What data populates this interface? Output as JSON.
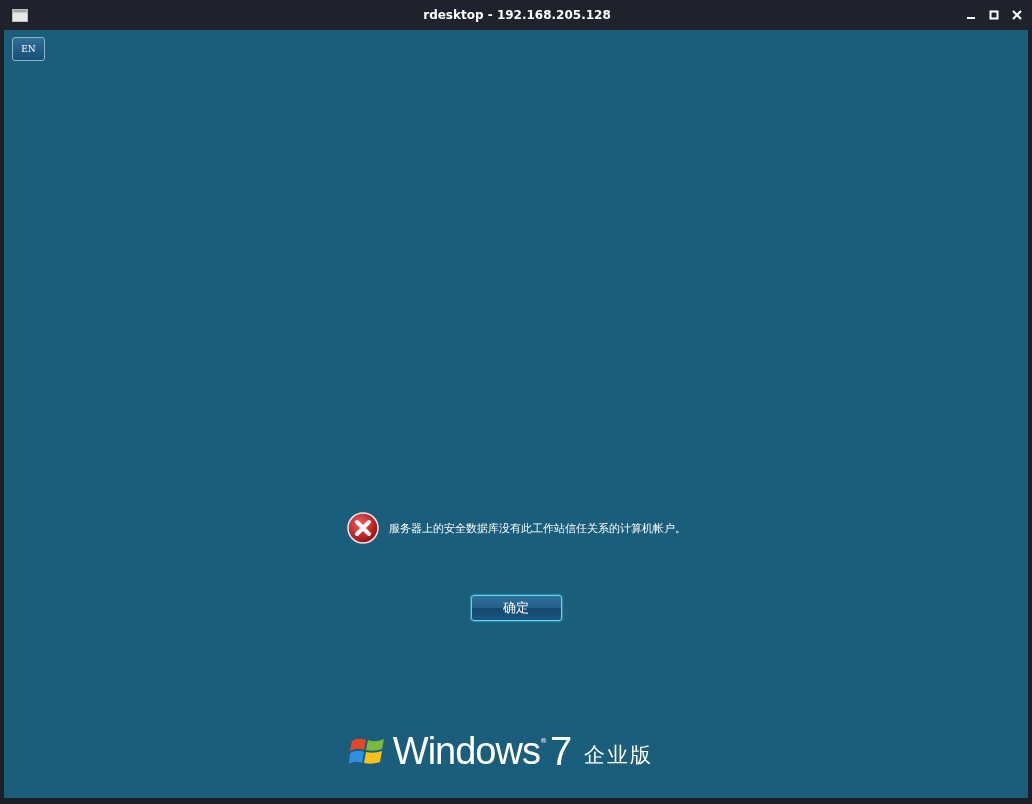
{
  "window": {
    "title": "rdesktop - 192.168.205.128"
  },
  "language_button": {
    "label": "EN"
  },
  "message": {
    "text": "服务器上的安全数据库没有此工作站信任关系的计算机帐户。"
  },
  "ok_button": {
    "label": "确定"
  },
  "branding": {
    "wordmark": "Windows",
    "registered": "®",
    "version": "7",
    "edition": "企业版"
  }
}
